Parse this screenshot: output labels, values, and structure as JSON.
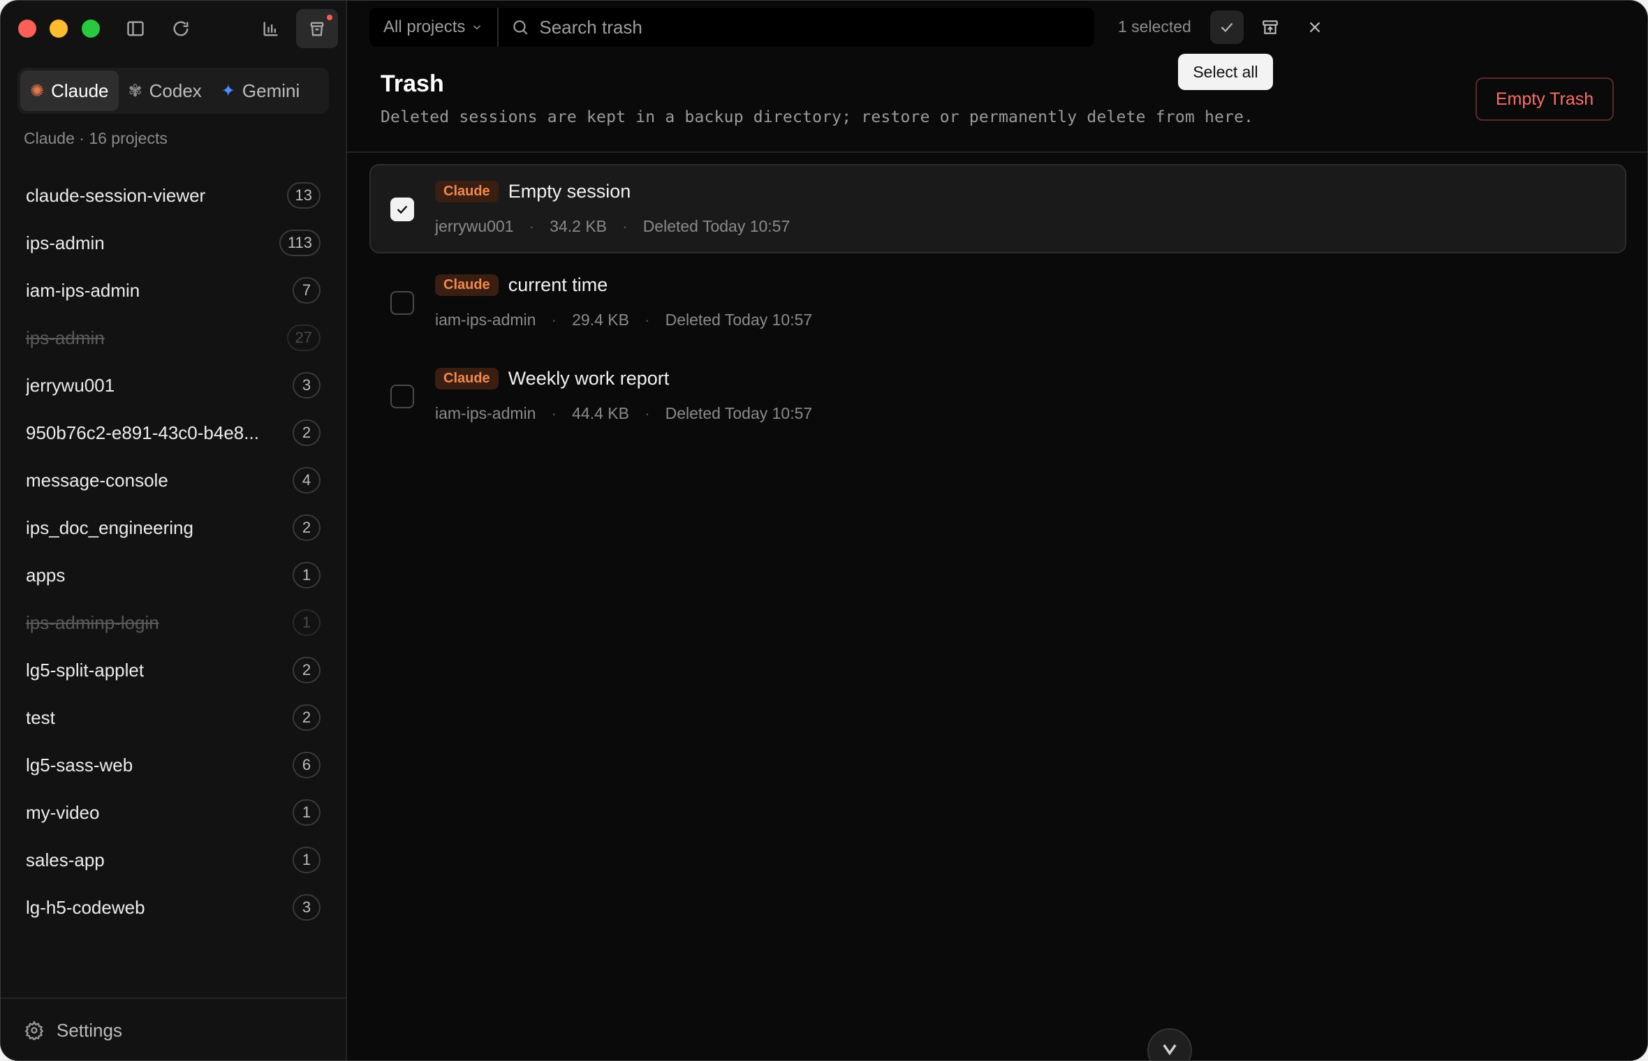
{
  "sidebar": {
    "providers": [
      {
        "label": "Claude",
        "icon": "claude-sparkle-icon",
        "active": true
      },
      {
        "label": "Codex",
        "icon": "openai-icon",
        "active": false
      },
      {
        "label": "Gemini",
        "icon": "gemini-star-icon",
        "active": false
      }
    ],
    "subtitle": "Claude · 16 projects",
    "projects": [
      {
        "name": "claude-session-viewer",
        "count": "13",
        "muted": false
      },
      {
        "name": "ips-admin",
        "count": "113",
        "muted": false
      },
      {
        "name": "iam-ips-admin",
        "count": "7",
        "muted": false
      },
      {
        "name": "ips-admin",
        "count": "27",
        "muted": true
      },
      {
        "name": "jerrywu001",
        "count": "3",
        "muted": false
      },
      {
        "name": "950b76c2-e891-43c0-b4e8...",
        "count": "2",
        "muted": false
      },
      {
        "name": "message-console",
        "count": "4",
        "muted": false
      },
      {
        "name": "ips_doc_engineering",
        "count": "2",
        "muted": false
      },
      {
        "name": "apps",
        "count": "1",
        "muted": false
      },
      {
        "name": "ips-adminp-login",
        "count": "1",
        "muted": true
      },
      {
        "name": "lg5-split-applet",
        "count": "2",
        "muted": false
      },
      {
        "name": "test",
        "count": "2",
        "muted": false
      },
      {
        "name": "lg5-sass-web",
        "count": "6",
        "muted": false
      },
      {
        "name": "my-video",
        "count": "1",
        "muted": false
      },
      {
        "name": "sales-app",
        "count": "1",
        "muted": false
      },
      {
        "name": "lg-h5-codeweb",
        "count": "3",
        "muted": false
      }
    ],
    "settings_label": "Settings"
  },
  "toolbar": {
    "scope_label": "All projects",
    "search_placeholder": "Search trash",
    "selected_count": "1 selected",
    "tooltip": "Select all"
  },
  "header": {
    "title": "Trash",
    "description": "Deleted sessions are kept in a backup directory; restore or permanently delete from here.",
    "empty_button": "Empty Trash"
  },
  "sessions": [
    {
      "badge": "Claude",
      "title": "Empty session",
      "project": "jerrywu001",
      "size": "34.2 KB",
      "deleted": "Deleted Today 10:57",
      "selected": true
    },
    {
      "badge": "Claude",
      "title": "current time",
      "project": "iam-ips-admin",
      "size": "29.4 KB",
      "deleted": "Deleted Today 10:57",
      "selected": false
    },
    {
      "badge": "Claude",
      "title": "Weekly work report",
      "project": "iam-ips-admin",
      "size": "44.4 KB",
      "deleted": "Deleted Today 10:57",
      "selected": false
    }
  ],
  "colors": {
    "accent_orange": "#f08a4b",
    "danger": "#ff6b6b",
    "gemini_blue": "#4c8dff"
  }
}
